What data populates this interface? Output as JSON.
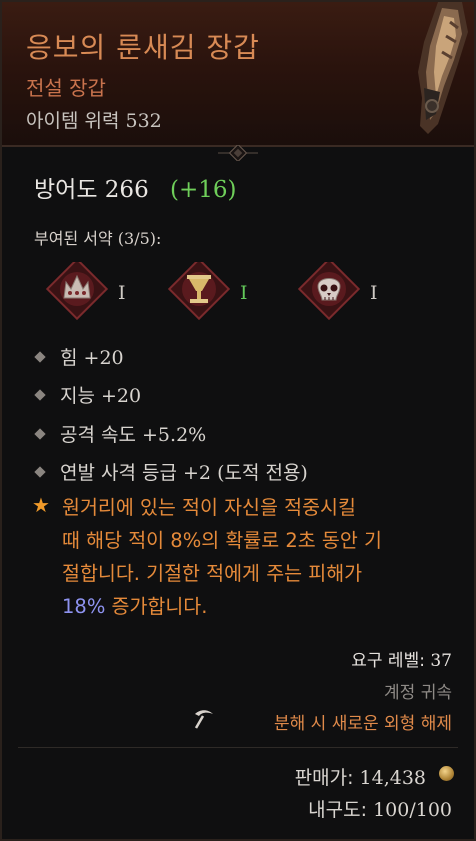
{
  "item": {
    "name": "응보의 룬새김 장갑",
    "type": "전설 장갑",
    "power_label": "아이템 위력",
    "power_value": "532"
  },
  "armor": {
    "label": "방어도",
    "value": "266",
    "bonus": "(+16)"
  },
  "seals": {
    "title": "부여된 서약",
    "count": "(3/5):",
    "items": [
      {
        "icon": "crown-seal-icon",
        "rank": "I",
        "rank_color": "#cfcac4"
      },
      {
        "icon": "goblet-seal-icon",
        "rank": "I",
        "rank_color": "#63c85a"
      },
      {
        "icon": "skull-seal-icon",
        "rank": "I",
        "rank_color": "#cfcac4"
      }
    ]
  },
  "stats": [
    {
      "name": "힘",
      "value": "+20"
    },
    {
      "name": "지능",
      "value": "+20"
    },
    {
      "name": "공격 속도",
      "value": "+5.2%"
    },
    {
      "name": "연발 사격 등급",
      "value": "+2 (도적 전용)"
    }
  ],
  "legendary": {
    "line1": "원거리에 있는 적이 자신을 적중시킬",
    "line2": "때 해당 적이 8%의 확률로 2초 동안 기",
    "line3": "절합니다. 기절한 적에게 주는 피해가",
    "line4_value": "18%",
    "line4_rest": "증가합니다."
  },
  "requirements": {
    "level_label": "요구 레벨:",
    "level_value": "37",
    "bound": "계정 귀속",
    "salvage": "분해 시 새로운 외형 해제"
  },
  "footer": {
    "price_label": "판매가:",
    "price_value": "14,438",
    "durability_label": "내구도:",
    "durability_value": "100/100"
  },
  "colors": {
    "title": "#d88a55",
    "legendary": "#e58a3a",
    "bonus": "#6fcf5a",
    "highlight_blue": "#8e93f0"
  }
}
